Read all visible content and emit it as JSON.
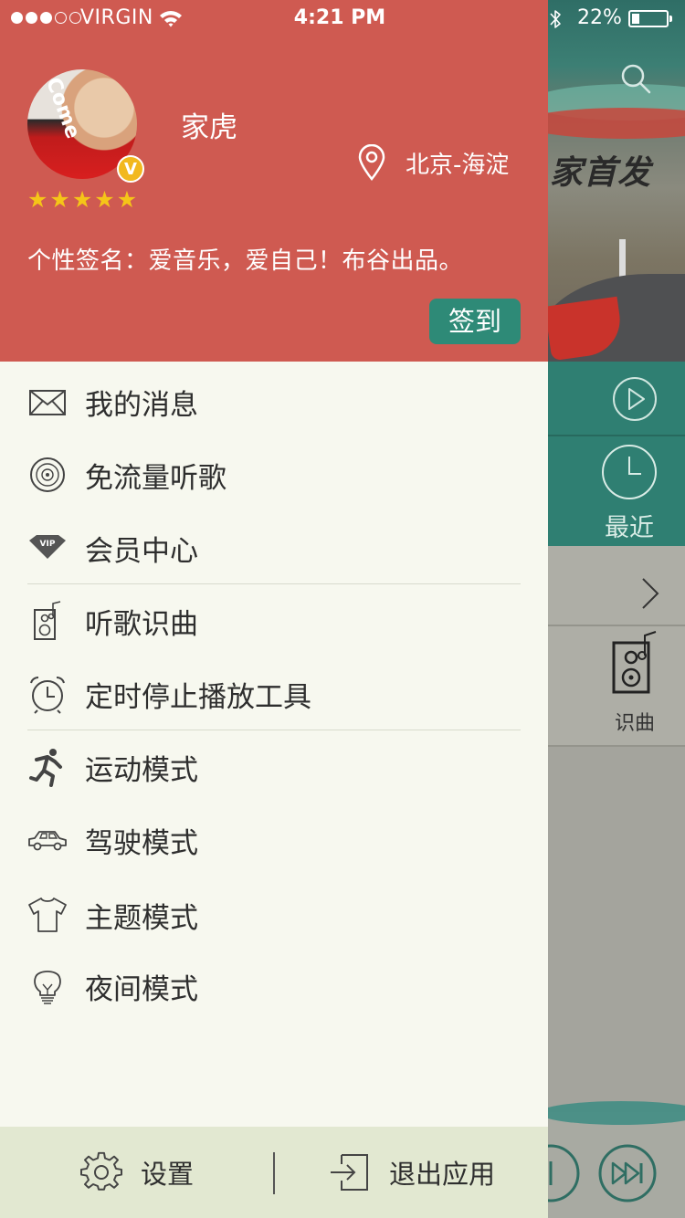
{
  "status_bar": {
    "carrier": "VIRGIN",
    "time": "4:21 PM",
    "battery": "22%",
    "battery_level": 0.22,
    "signal_bars": 3,
    "signal_total": 5
  },
  "profile": {
    "username": "家虎",
    "badge": "V",
    "rating": 5,
    "location": "北京-海淀",
    "signature": "个性签名：爱音乐，爱自己！布谷出品。",
    "checkin_label": "签到"
  },
  "menu": {
    "items": [
      {
        "label": "我的消息",
        "icon": "envelope-icon"
      },
      {
        "label": "免流量听歌",
        "icon": "vinyl-disc-icon"
      },
      {
        "label": "会员中心",
        "icon": "vip-diamond-icon"
      },
      {
        "label": "听歌识曲",
        "icon": "speaker-note-icon"
      },
      {
        "label": "定时停止播放工具",
        "icon": "alarm-clock-icon"
      },
      {
        "label": "运动模式",
        "icon": "running-man-icon"
      },
      {
        "label": "驾驶模式",
        "icon": "car-icon"
      },
      {
        "label": "主题模式",
        "icon": "tshirt-icon"
      },
      {
        "label": "夜间模式",
        "icon": "light-bulb-icon"
      }
    ]
  },
  "footer": {
    "settings_label": "设置",
    "exit_label": "退出应用"
  },
  "background_page": {
    "recent_label": "最近",
    "recognize_label": "识曲",
    "hero_text": "家首发"
  },
  "colors": {
    "profile_bg": "#cf5a51",
    "accent_green": "#2e8a77",
    "drawer_bg": "#f7f8ef",
    "footer_bg": "#e2e8d1",
    "teal": "#2f7f72"
  }
}
